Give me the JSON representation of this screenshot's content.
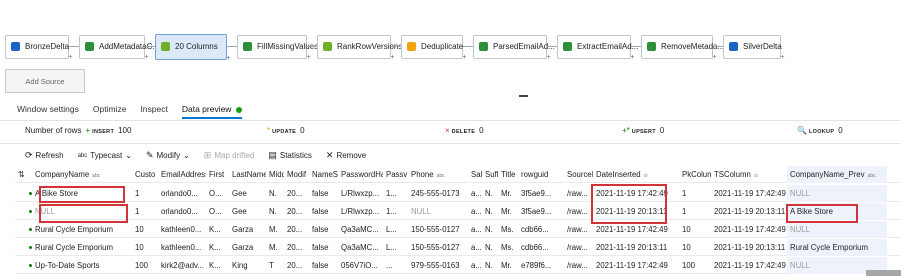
{
  "pipeline": {
    "nodes": [
      {
        "label": "BronzeDelta",
        "icon": "source-icon",
        "color": "#1a62c5"
      },
      {
        "label": "AddMetadataC...",
        "icon": "derived-column-icon",
        "color": "#2d8f3a"
      },
      {
        "label": "20 Columns",
        "icon": "select-icon",
        "color": "#6fb02a"
      },
      {
        "label": "FillMissingValues",
        "icon": "derived-column-icon",
        "color": "#2d8f3a"
      },
      {
        "label": "RankRowVersions",
        "icon": "window-icon",
        "color": "#6fb02a"
      },
      {
        "label": "Deduplicate",
        "icon": "filter-icon",
        "color": "#f0a30a"
      },
      {
        "label": "ParsedEmailAd...",
        "icon": "parse-icon",
        "color": "#2d8f3a"
      },
      {
        "label": "ExtractEmailAd...",
        "icon": "derived-column-icon",
        "color": "#2d8f3a"
      },
      {
        "label": "RemoveMetada...",
        "icon": "select-icon",
        "color": "#2d8f3a"
      },
      {
        "label": "SilverDelta",
        "icon": "sink-icon",
        "color": "#1a62c5"
      }
    ],
    "add_source": "Add Source"
  },
  "tabs": [
    {
      "label": "Window settings"
    },
    {
      "label": "Optimize"
    },
    {
      "label": "Inspect"
    },
    {
      "label": "Data preview"
    }
  ],
  "stats": {
    "rows_label": "Number of rows",
    "insert_label": "INSERT",
    "insert_value": "100",
    "update_label": "UPDATE",
    "update_value": "0",
    "delete_label": "DELETE",
    "delete_value": "0",
    "upsert_label": "UPSERT",
    "upsert_value": "0",
    "lookup_label": "LOOKUP",
    "lookup_value": "0"
  },
  "toolbar": {
    "refresh": "Refresh",
    "typecast": "Typecast",
    "modify": "Modify",
    "map_drifted": "Map drifted",
    "statistics": "Statistics",
    "remove": "Remove"
  },
  "columns": [
    "",
    "CompanyName",
    "Custo",
    "EmailAddress",
    "First",
    "LastName",
    "Midd",
    "Modif",
    "NameS",
    "PasswordHa",
    "Passv",
    "Phone",
    "Sale",
    "Suff",
    "Title",
    "rowguid",
    "SourceF",
    "DateInserted",
    "PkColum",
    "TSColumn",
    "CompanyName_Prev"
  ],
  "rows": [
    [
      "",
      "A Bike Store",
      "1",
      "orlando0...",
      "O...",
      "Gee",
      "N.",
      "20...",
      "false",
      "L/Rlwxzp...",
      "1...",
      "245-555-0173",
      "a...",
      "N.",
      "Mr.",
      "3f5ae9...",
      "/raw...",
      "2021-11-19 17:42:49",
      "1",
      "2021-11-19 17:42:49",
      "NULL"
    ],
    [
      "",
      "NULL",
      "1",
      "orlando0...",
      "O...",
      "Gee",
      "N.",
      "20...",
      "false",
      "L/Rlwxzp...",
      "1...",
      "NULL",
      "a...",
      "N.",
      "Mr.",
      "3f5ae9...",
      "/raw...",
      "2021-11-19 20:13:11",
      "1",
      "2021-11-19 20:13:11",
      "A Bike Store"
    ],
    [
      "",
      "Rural Cycle Emporium",
      "10",
      "kathleen0...",
      "K...",
      "Garza",
      "M.",
      "20...",
      "false",
      "Qa3aMC...",
      "L...",
      "150-555-0127",
      "a...",
      "N.",
      "Ms.",
      "cdb66...",
      "/raw...",
      "2021-11-19 17:42:49",
      "10",
      "2021-11-19 17:42:49",
      "NULL"
    ],
    [
      "",
      "Rural Cycle Emporium",
      "10",
      "kathleen0...",
      "K...",
      "Garza",
      "M.",
      "20...",
      "false",
      "Qa3aMC...",
      "L...",
      "150-555-0127",
      "a...",
      "N.",
      "Ms.",
      "cdb66...",
      "/raw...",
      "2021-11-19 20:13:11",
      "10",
      "2021-11-19 20:13:11",
      "Rural Cycle Emporium"
    ],
    [
      "",
      "Up-To-Date Sports",
      "100",
      "kirk2@adv...",
      "K...",
      "King",
      "T",
      "20...",
      "false",
      "056V7iO...",
      "...",
      "979-555-0163",
      "a...",
      "N.",
      "Mr.",
      "e789f6...",
      "/raw...",
      "2021-11-19 17:42:49",
      "100",
      "2021-11-19 17:42:49",
      "NULL"
    ]
  ],
  "colors": {
    "accent": "#0078d4",
    "highlight": "#d13438",
    "success": "#13a10e"
  }
}
